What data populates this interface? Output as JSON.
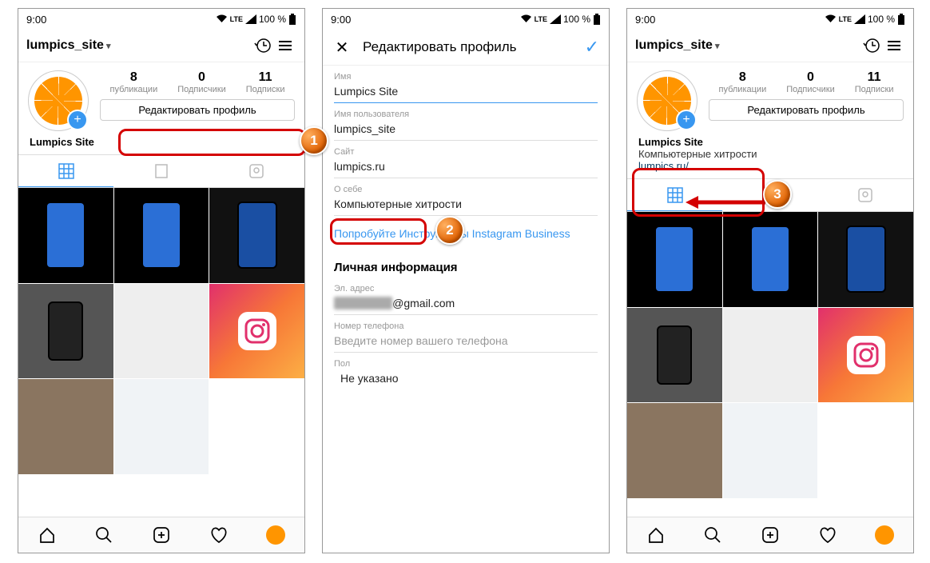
{
  "status": {
    "time": "9:00",
    "net": "LTE",
    "battery": "100 %"
  },
  "profile": {
    "username": "lumpics_site",
    "displayName": "Lumpics Site",
    "desc": "Компьютерные хитрости",
    "link": "lumpics.ru/",
    "editLabel": "Редактировать профиль",
    "stats": {
      "posts": {
        "n": "8",
        "l": "публикации"
      },
      "followers": {
        "n": "0",
        "l": "Подписчики"
      },
      "following": {
        "n": "11",
        "l": "Подписки"
      }
    }
  },
  "edit": {
    "title": "Редактировать профиль",
    "nameLbl": "Имя",
    "nameVal": "Lumpics Site",
    "userLbl": "Имя пользователя",
    "userVal": "lumpics_site",
    "siteLbl": "Сайт",
    "siteVal": "lumpics.ru",
    "bioLbl": "О себе",
    "bioVal": "Компьютерные хитрости",
    "bizLink": "Попробуйте Инструменты Instagram Business",
    "sectPersonal": "Личная информация",
    "emailLbl": "Эл. адрес",
    "emailSuffix": "@gmail.com",
    "phoneLbl": "Номер телефона",
    "phonePh": "Введите номер вашего телефона",
    "sexLbl": "Пол",
    "sexVal": "Не указано"
  },
  "markers": {
    "m1": "1",
    "m2": "2",
    "m3": "3"
  }
}
